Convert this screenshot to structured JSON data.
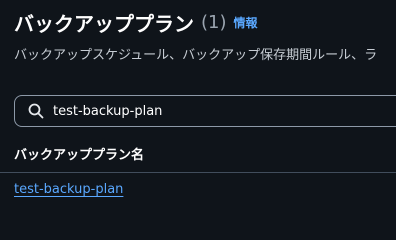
{
  "header": {
    "title": "バックアッププラン",
    "count": "(1)",
    "info_link": "情報"
  },
  "description": "バックアップスケジュール、バックアップ保存期間ルール、ラ",
  "search": {
    "icon": "search-icon",
    "value": "test-backup-plan"
  },
  "table": {
    "columns": [
      "バックアッププラン名"
    ],
    "rows": [
      {
        "name": "test-backup-plan"
      }
    ]
  },
  "colors": {
    "background": "#0f141a",
    "link": "#5aa8ff",
    "border": "#8d99a8"
  }
}
